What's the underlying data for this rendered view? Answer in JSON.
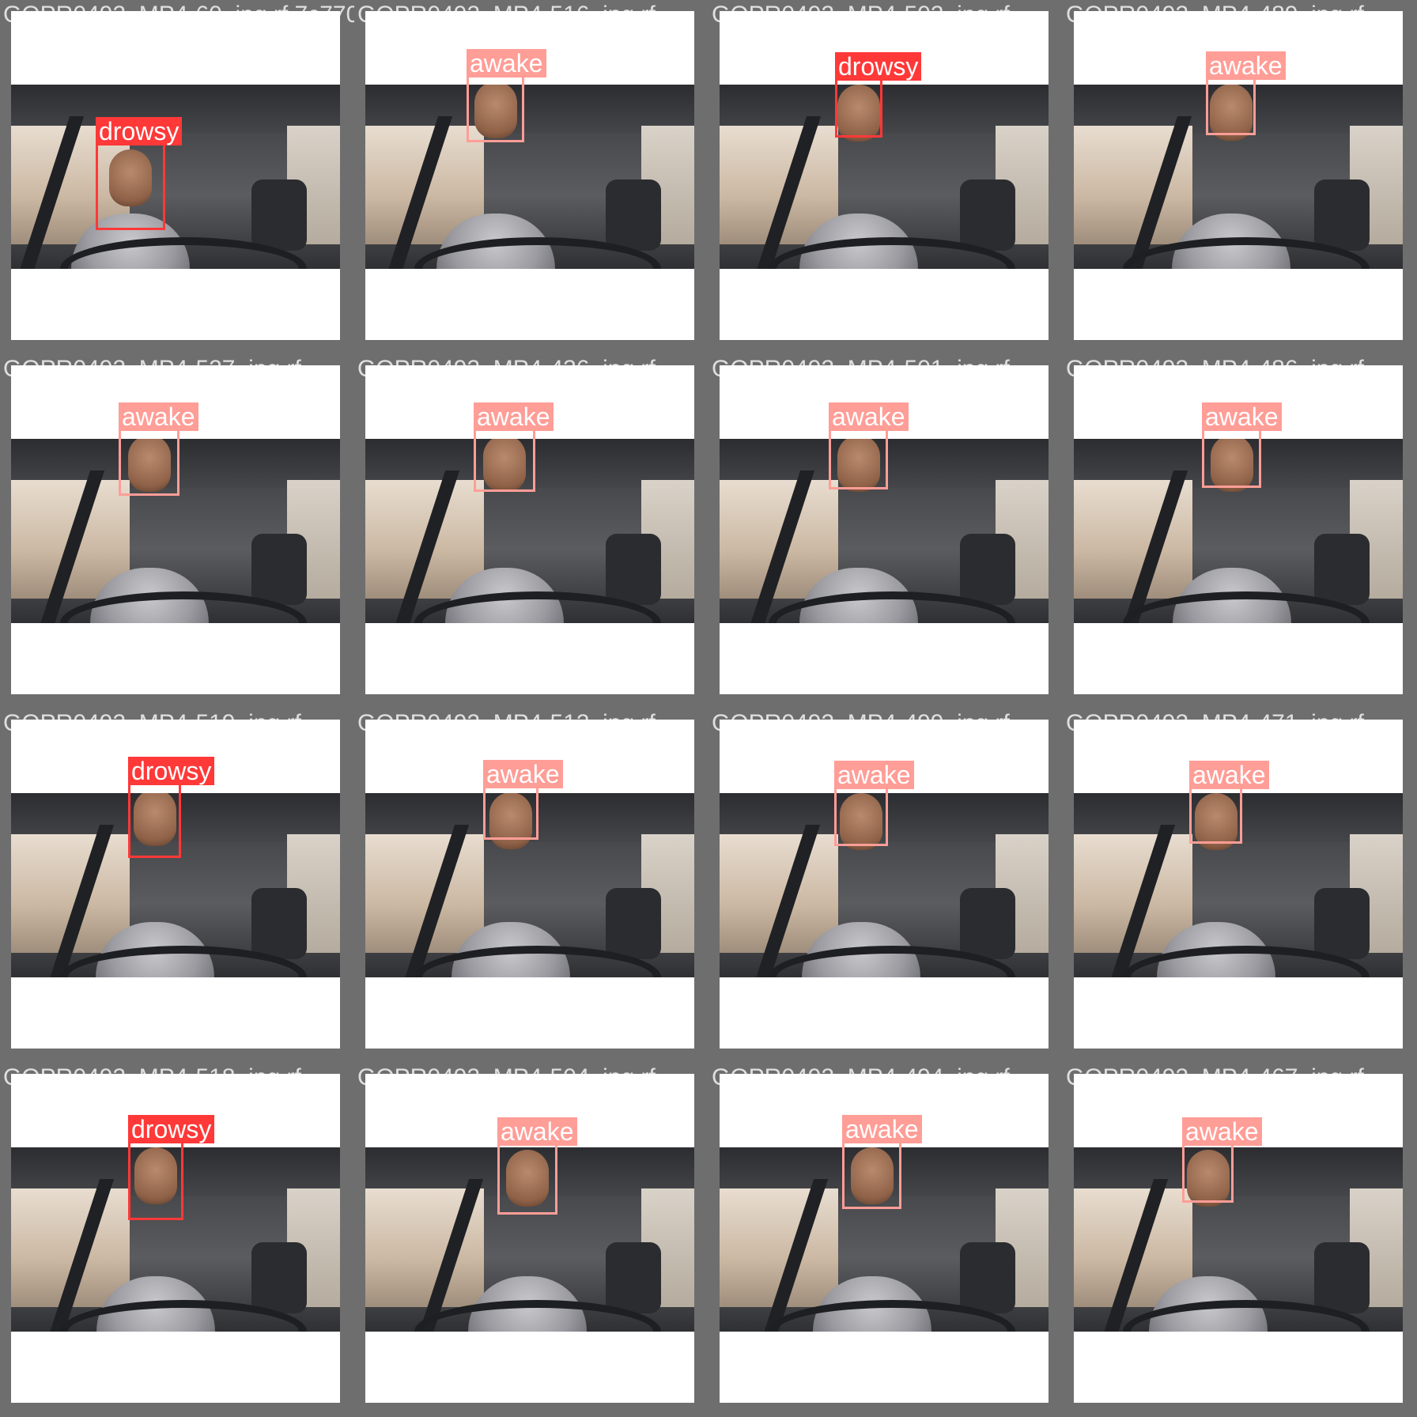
{
  "mosaic": {
    "tiles": [
      {
        "filename": "GOPR0492_MP4-60_jpg.rf.7c770740523d0d7e516_jpg.rf.",
        "label": "drowsy"
      },
      {
        "filename": "GOPR0492_MP4-516_jpg.rf.",
        "label": "awake"
      },
      {
        "filename": "GOPR0492_MP4-502_jpg.rf.",
        "label": "drowsy"
      },
      {
        "filename": "GOPR0492_MP4-489_jpg.rf.",
        "label": "awake"
      },
      {
        "filename": "GOPR0492_MP4-527_jpg.rf.",
        "label": "awake"
      },
      {
        "filename": "GOPR0492_MP4-436_jpg.rf.",
        "label": "awake"
      },
      {
        "filename": "GOPR0492_MP4-501_jpg.rf.",
        "label": "awake"
      },
      {
        "filename": "GOPR0492_MP4-486_jpg.rf.",
        "label": "awake"
      },
      {
        "filename": "GOPR0492_MP4-519_jpg.rf.",
        "label": "drowsy"
      },
      {
        "filename": "GOPR0492_MP4-512_jpg.rf.",
        "label": "awake"
      },
      {
        "filename": "GOPR0492_MP4-499_jpg.rf.",
        "label": "awake"
      },
      {
        "filename": "GOPR0492_MP4-471_jpg.rf.",
        "label": "awake"
      },
      {
        "filename": "GOPR0492_MP4-518_jpg.rf.",
        "label": "drowsy"
      },
      {
        "filename": "GOPR0492_MP4-504_jpg.rf.",
        "label": "awake"
      },
      {
        "filename": "GOPR0492_MP4-494_jpg.rf.",
        "label": "awake"
      },
      {
        "filename": "GOPR0492_MP4-467_jpg.rf.",
        "label": "awake"
      }
    ]
  }
}
